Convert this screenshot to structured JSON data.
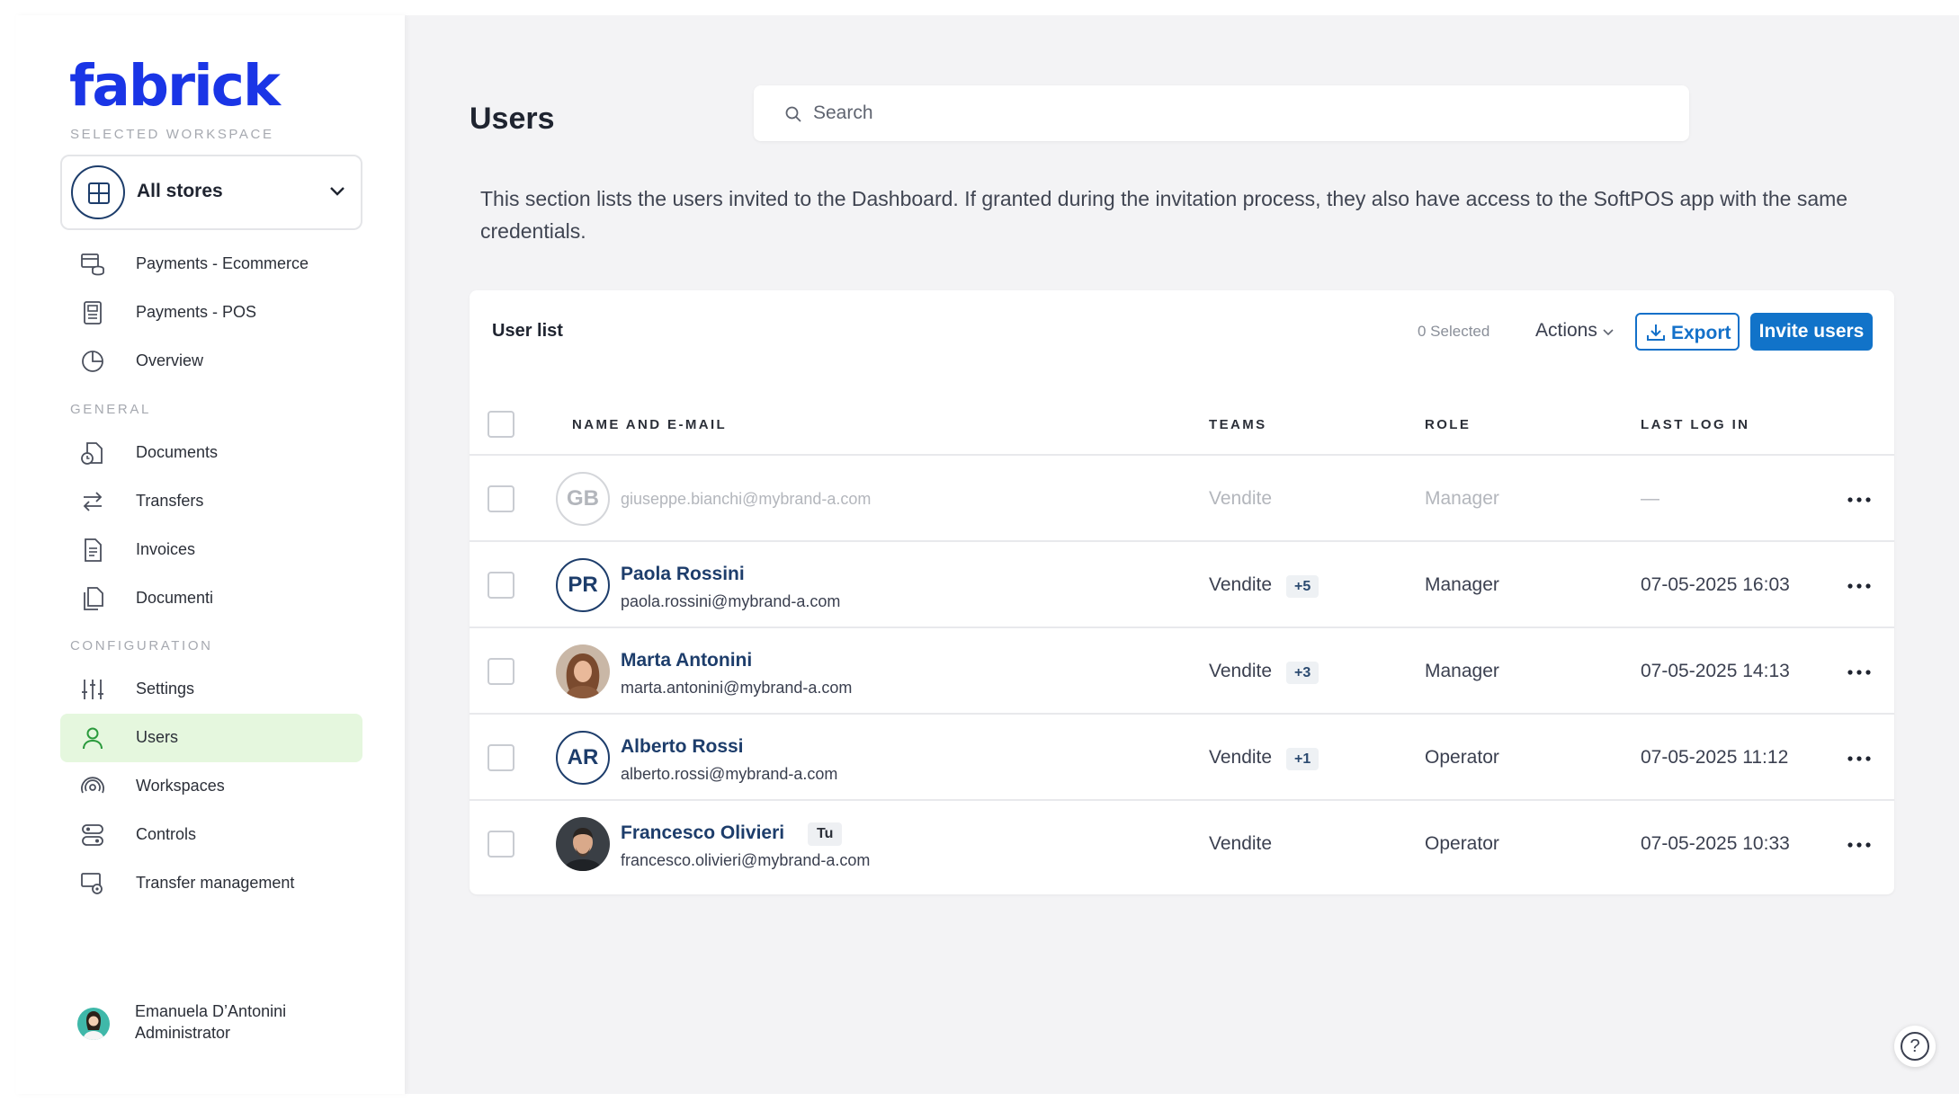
{
  "sidebar": {
    "logo": "fabrick",
    "workspace_section": "Selected workspace",
    "workspace_value": "All stores",
    "top_items": [
      {
        "label": "Payments - Ecommerce",
        "icon": "payments-ecommerce-icon"
      },
      {
        "label": "Payments - POS",
        "icon": "pos-terminal-icon"
      },
      {
        "label": "Overview",
        "icon": "pie-chart-icon"
      }
    ],
    "general_section": "General",
    "general_items": [
      {
        "label": "Documents",
        "icon": "document-clock-icon"
      },
      {
        "label": "Transfers",
        "icon": "transfer-arrows-icon"
      },
      {
        "label": "Invoices",
        "icon": "invoice-icon"
      },
      {
        "label": "Documenti",
        "icon": "documents-copy-icon"
      }
    ],
    "config_section": "Configuration",
    "config_items": [
      {
        "label": "Settings",
        "icon": "sliders-icon"
      },
      {
        "label": "Users",
        "icon": "user-icon",
        "active": true
      },
      {
        "label": "Workspaces",
        "icon": "workspace-icon"
      },
      {
        "label": "Controls",
        "icon": "controls-icon"
      },
      {
        "label": "Transfer management",
        "icon": "transfer-settings-icon"
      }
    ],
    "profile": {
      "name": "Emanuela D’Antonini",
      "role": "Administrator"
    }
  },
  "header": {
    "title": "Users",
    "search_placeholder": "Search"
  },
  "intro_text": "This section lists the users invited to the Dashboard. If granted during the invitation process, they also have access to the SoftPOS app with the same credentials.",
  "card": {
    "title": "User list",
    "selected_count": "0 Selected",
    "actions_label": "Actions",
    "export_label": "Export",
    "invite_label": "Invite users",
    "columns": {
      "name": "Name and e-mail",
      "teams": "Teams",
      "role": "Role",
      "last_login": "Last log in"
    },
    "rows": [
      {
        "initials": "GB",
        "name": "",
        "email": "giuseppe.bianchi@mybrand-a.com",
        "team": "Vendite",
        "team_extra": "",
        "role": "Manager",
        "last_login": "—",
        "pending": true
      },
      {
        "initials": "PR",
        "name": "Paola Rossini",
        "email": "paola.rossini@mybrand-a.com",
        "team": "Vendite",
        "team_extra": "+5",
        "role": "Manager",
        "last_login": "07-05-2025 16:03"
      },
      {
        "initials": "",
        "name": "Marta Antonini",
        "email": "marta.antonini@mybrand-a.com",
        "team": "Vendite",
        "team_extra": "+3",
        "role": "Manager",
        "last_login": "07-05-2025 14:13",
        "photo": true
      },
      {
        "initials": "AR",
        "name": "Alberto Rossi",
        "email": "alberto.rossi@mybrand-a.com",
        "team": "Vendite",
        "team_extra": "+1",
        "role": "Operator",
        "last_login": "07-05-2025 11:12"
      },
      {
        "initials": "",
        "name": "Francesco Olivieri",
        "badge": "Tu",
        "email": "francesco.olivieri@mybrand-a.com",
        "team": "Vendite",
        "team_extra": "",
        "role": "Operator",
        "last_login": "07-05-2025 10:33",
        "photo": true
      }
    ]
  },
  "help_label": "?",
  "colors": {
    "brand": "#1a35e6",
    "primary": "#1173c9",
    "active_nav": "#e5f7de",
    "navy": "#1d3d6b"
  }
}
